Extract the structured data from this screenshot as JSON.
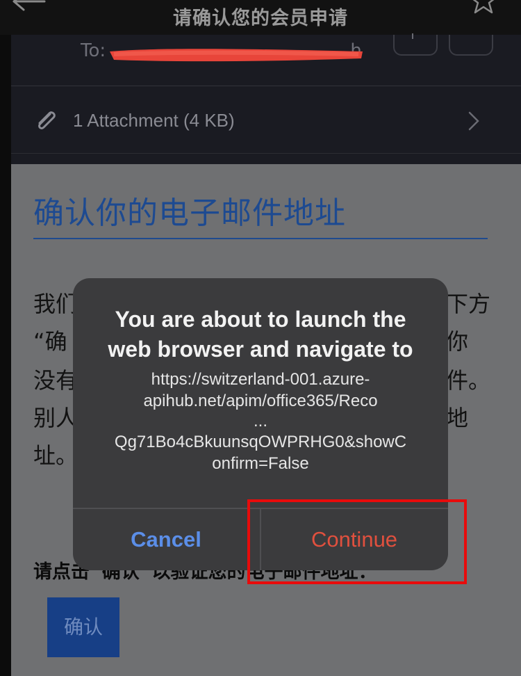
{
  "topbar": {
    "title": "请确认您的会员申请",
    "back_icon": "back-arrow-icon",
    "star_icon": "star-icon"
  },
  "header": {
    "to_label": "To: ",
    "to_tail": "h",
    "attachment_label": "1 Attachment (4 KB)"
  },
  "email": {
    "heading": "确认你的电子邮件地址",
    "paragraph_lines": [
      {
        "left": "我们",
        "right": "下方"
      },
      {
        "left": "“确",
        "right": "你"
      },
      {
        "left": "没有",
        "right": "件。"
      },
      {
        "left": "别人",
        "right": "地"
      },
      {
        "left": "址。",
        "right": ""
      }
    ],
    "instruction": "请点击“确认”以验证您的电子邮件地址：",
    "confirm_button": "确认"
  },
  "dialog": {
    "title_line1": "You are about to launch the",
    "title_line2": "web browser and navigate to",
    "url_lines": [
      "https://switzerland-001.azure-",
      "apihub.net/apim/office365/Reco",
      "...",
      "Qg71Bo4cBkuunsqOWPRHG0&showC",
      "onfirm=False"
    ],
    "cancel_label": "Cancel",
    "continue_label": "Continue"
  },
  "colors": {
    "accent_blue": "#5b8ee8",
    "destructive_red": "#e0503e",
    "highlight_red": "#e80b0b",
    "heading_blue": "#1d4a91"
  }
}
